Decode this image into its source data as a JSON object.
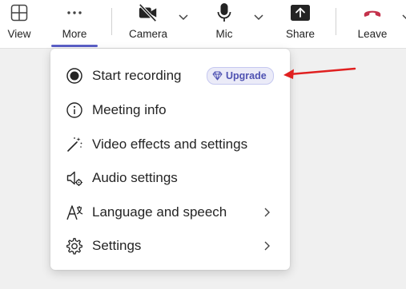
{
  "toolbar": {
    "view_label": "View",
    "more_label": "More",
    "camera_label": "Camera",
    "mic_label": "Mic",
    "share_label": "Share",
    "leave_label": "Leave",
    "active_tab": "More"
  },
  "menu": {
    "items": [
      {
        "label": "Start recording",
        "icon": "record-icon",
        "badge": "Upgrade",
        "submenu": false
      },
      {
        "label": "Meeting info",
        "icon": "info-icon",
        "submenu": false
      },
      {
        "label": "Video effects and settings",
        "icon": "magic-wand-icon",
        "submenu": false
      },
      {
        "label": "Audio settings",
        "icon": "speaker-settings-icon",
        "submenu": false
      },
      {
        "label": "Language and speech",
        "icon": "language-icon",
        "submenu": true
      },
      {
        "label": "Settings",
        "icon": "gear-icon",
        "submenu": true
      }
    ]
  },
  "colors": {
    "accent": "#5b5fc7",
    "leave_red": "#c4314b",
    "annotation_red": "#e02020",
    "upgrade_text": "#4f52b2",
    "upgrade_bg": "#ebebf8"
  }
}
